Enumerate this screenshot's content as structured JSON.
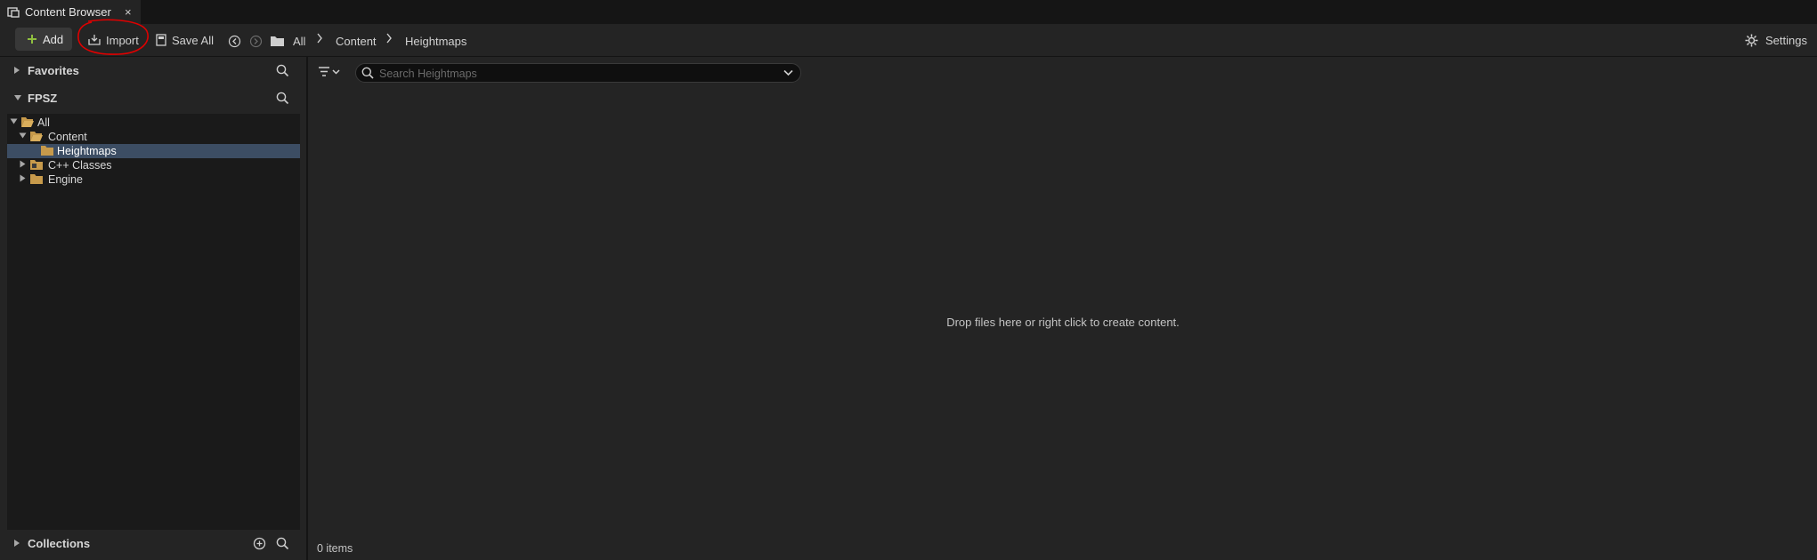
{
  "tab": {
    "title": "Content Browser",
    "close": "×",
    "icon": "content-browser-icon"
  },
  "toolbar": {
    "add_label": "Add",
    "import_label": "Import",
    "save_all_label": "Save All",
    "settings_label": "Settings",
    "breadcrumb": [
      "All",
      "Content",
      "Heightmaps"
    ]
  },
  "sidebar": {
    "favorites_title": "Favorites",
    "project_title": "FPSZ",
    "collections_title": "Collections",
    "tree": [
      {
        "label": "All",
        "level": 0,
        "expanded": true,
        "selected": false
      },
      {
        "label": "Content",
        "level": 1,
        "expanded": true,
        "selected": false
      },
      {
        "label": "Heightmaps",
        "level": 2,
        "expanded": false,
        "selected": true
      },
      {
        "label": "C++ Classes",
        "level": 1,
        "expanded": false,
        "selected": false
      },
      {
        "label": "Engine",
        "level": 1,
        "expanded": false,
        "selected": false
      }
    ]
  },
  "main": {
    "search_placeholder": "Search Heightmaps",
    "empty_message": "Drop files here or right click to create content.",
    "items_count": "0 items"
  },
  "colors": {
    "accent_add": "#8fbf3f",
    "selection": "#3c4d63",
    "folder": "#c79a4b",
    "annotation": "#e00000"
  }
}
